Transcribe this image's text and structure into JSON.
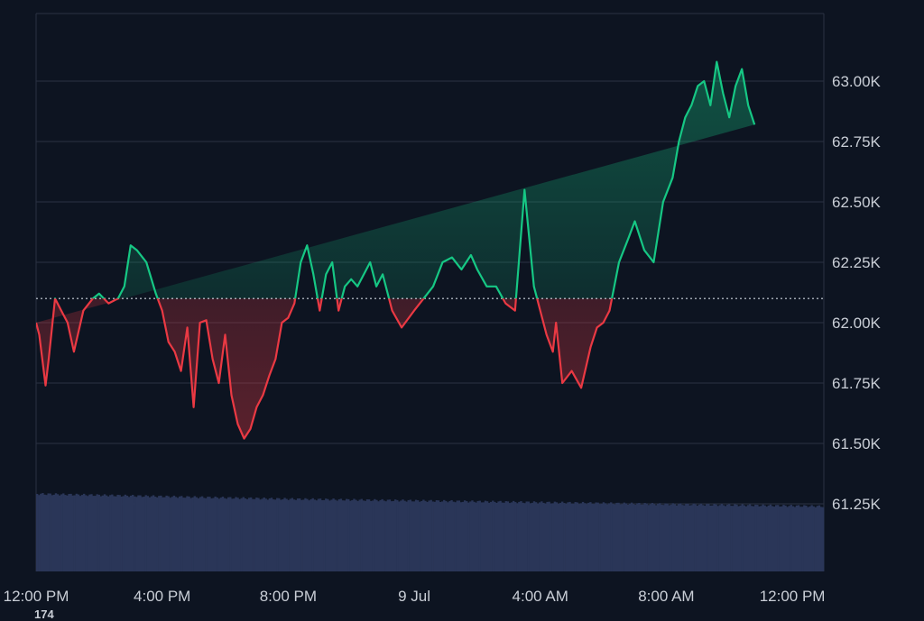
{
  "chart_data": {
    "type": "line",
    "x_tick_labels": [
      "12:00 PM",
      "4:00 PM",
      "8:00 PM",
      "9 Jul",
      "4:00 AM",
      "8:00 AM",
      "12:00 PM"
    ],
    "y_tick_labels": [
      "61.25K",
      "61.50K",
      "61.75K",
      "62.00K",
      "62.25K",
      "62.50K",
      "62.75K",
      "63.00K"
    ],
    "y_ticks": [
      61250,
      61500,
      61750,
      62000,
      62250,
      62500,
      62750,
      63000
    ],
    "ylim": [
      60970,
      63280
    ],
    "baseline": 62100,
    "x_range_hours": [
      0,
      25
    ],
    "grid": true,
    "colors": {
      "above": "#16c784",
      "below": "#ea3943",
      "background": "#0d1421",
      "grid": "#2a3242",
      "volume": "#2a3658"
    },
    "series": [
      {
        "x_hours": [
          0,
          0.1,
          0.3,
          0.4,
          0.6,
          0.8,
          1.0,
          1.2,
          1.5,
          1.8,
          2.0,
          2.3,
          2.6,
          2.8,
          3.0,
          3.2,
          3.5,
          3.8,
          4.0,
          4.2,
          4.4,
          4.6,
          4.8,
          5.0,
          5.2,
          5.4,
          5.6,
          5.8,
          6.0,
          6.2,
          6.4,
          6.6,
          6.8,
          7.0,
          7.2,
          7.4,
          7.6,
          7.8,
          8.0,
          8.2,
          8.4,
          8.6,
          8.8,
          9.0,
          9.2,
          9.4,
          9.6,
          9.8,
          10.0,
          10.2,
          10.4,
          10.6,
          10.8,
          11.0,
          11.3,
          11.6,
          12.0,
          12.3,
          12.6,
          12.9,
          13.2,
          13.5,
          13.8,
          14.0,
          14.3,
          14.6,
          14.9,
          15.2,
          15.5,
          15.8,
          16.0,
          16.2,
          16.4,
          16.5,
          16.7,
          17.0,
          17.3,
          17.6,
          17.8,
          18.0,
          18.2,
          18.5,
          18.8,
          19.0,
          19.3,
          19.6,
          19.9,
          20.2,
          20.4,
          20.6,
          20.8,
          21.0,
          21.2,
          21.4,
          21.6,
          21.8,
          22.0,
          22.2,
          22.4,
          22.6,
          22.8,
          23.0,
          23.2,
          23.4,
          23.6,
          23.8,
          24.0,
          24.2,
          24.4,
          24.6,
          24.8,
          25.0
        ],
        "values": [
          62000,
          61950,
          61740,
          61850,
          62100,
          62050,
          62000,
          61880,
          62050,
          62100,
          62120,
          62080,
          62100,
          62150,
          62320,
          62300,
          62250,
          62120,
          62050,
          61920,
          61880,
          61800,
          61980,
          61650,
          62000,
          62010,
          61850,
          61750,
          61950,
          61700,
          61580,
          61520,
          61560,
          61650,
          61700,
          61780,
          61850,
          62000,
          62020,
          62080,
          62250,
          62320,
          62200,
          62050,
          62200,
          62250,
          62050,
          62150,
          62180,
          62150,
          62200,
          62250,
          62150,
          62200,
          62050,
          61980,
          62050,
          62100,
          62150,
          62250,
          62270,
          62220,
          62280,
          62220,
          62150,
          62150,
          62080,
          62050,
          62550,
          62150,
          62050,
          61950,
          61880,
          62000,
          61750,
          61800,
          61730,
          61900,
          61980,
          62000,
          62050,
          62250,
          62350,
          62420,
          62300,
          62250,
          62500,
          62600,
          62750,
          62850,
          62900,
          62980,
          63000,
          62900,
          63080,
          62950,
          62850,
          62980,
          63050,
          62900,
          62820
        ]
      }
    ]
  }
}
